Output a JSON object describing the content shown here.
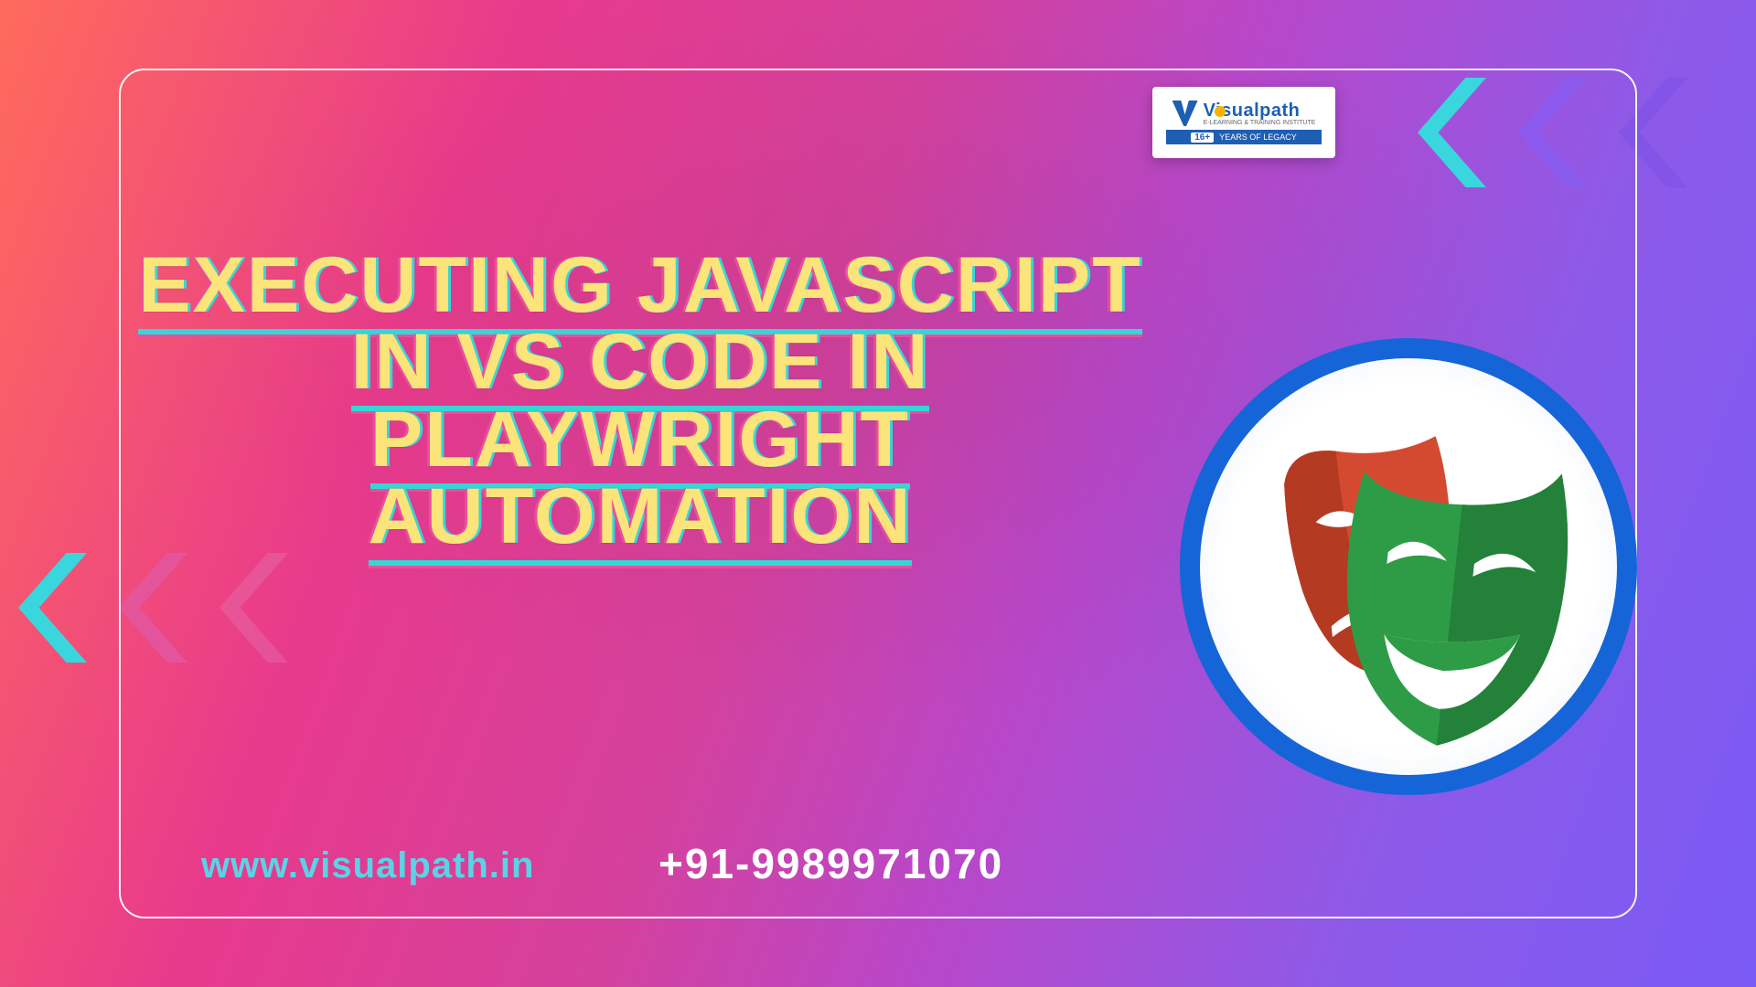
{
  "title_lines": [
    "EXECUTING JAVASCRIPT",
    "IN VS CODE IN",
    "PLAYWRIGHT",
    "AUTOMATION"
  ],
  "logo": {
    "brand": "Visualpath",
    "tagline": "E-LEARNING & TRAINING INSTITUTE",
    "badge_num": "16+",
    "badge_text": "YEARS OF LEGACY"
  },
  "website": "www.visualpath.in",
  "phone": "+91-9989971070",
  "icons": {
    "playwright": "playwright-masks-icon",
    "chevron": "chevron-icon",
    "logo": "visualpath-logo"
  }
}
